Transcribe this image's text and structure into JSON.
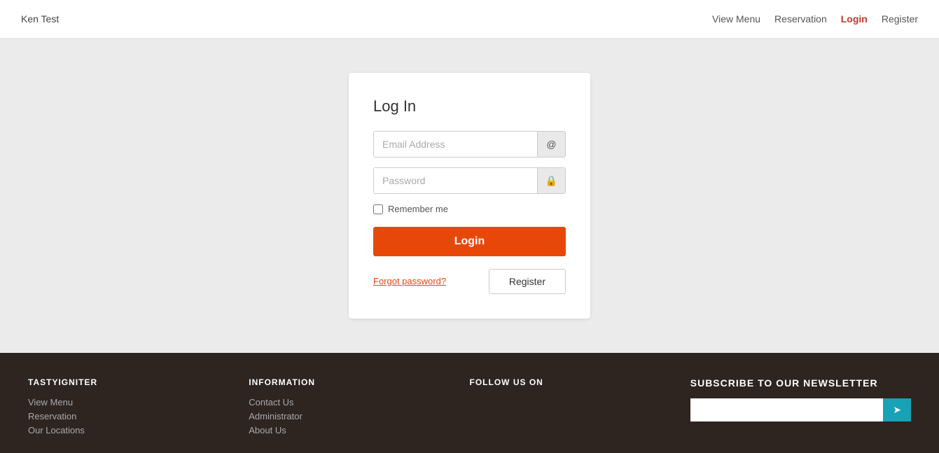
{
  "header": {
    "logo": "Ken Test",
    "nav": [
      {
        "label": "View Menu",
        "active": false
      },
      {
        "label": "Reservation",
        "active": false
      },
      {
        "label": "Login",
        "active": true
      },
      {
        "label": "Register",
        "active": false
      }
    ]
  },
  "login_card": {
    "title": "Log In",
    "email_placeholder": "Email Address",
    "email_icon": "@",
    "password_placeholder": "Password",
    "password_icon": "🔒",
    "remember_label": "Remember me",
    "login_button": "Login",
    "forgot_label": "Forgot password?",
    "register_button": "Register"
  },
  "footer": {
    "col1": {
      "heading": "TASTYIGNITER",
      "links": [
        "View Menu",
        "Reservation",
        "Our Locations"
      ]
    },
    "col2": {
      "heading": "INFORMATION",
      "links": [
        "Contact Us",
        "Administrator",
        "About Us"
      ]
    },
    "col3": {
      "heading": "FOLLOW US ON"
    },
    "col4": {
      "heading": "Subscribe to our newsletter",
      "placeholder": ""
    }
  }
}
